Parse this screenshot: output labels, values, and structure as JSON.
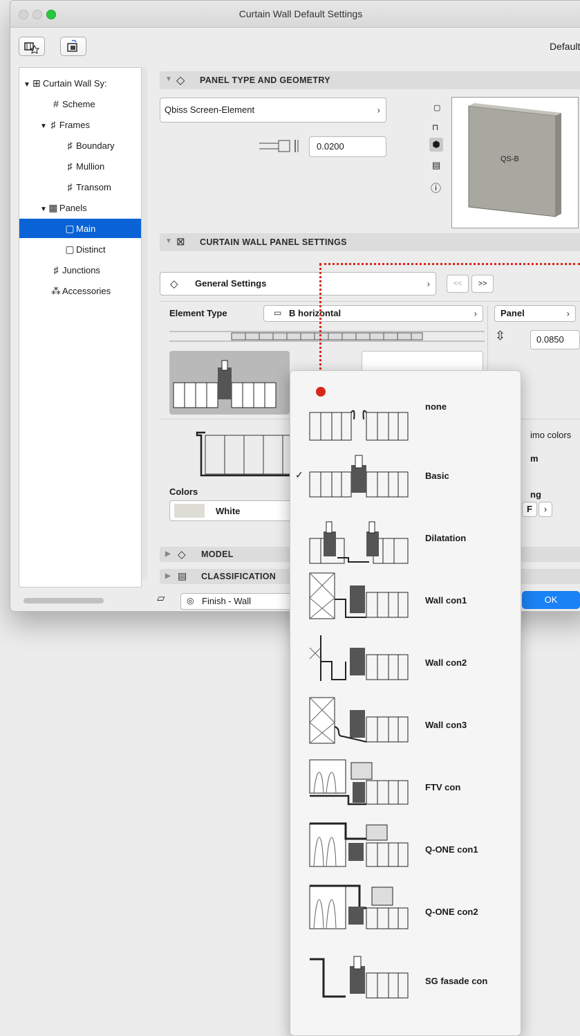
{
  "window": {
    "title": "Curtain Wall Default Settings",
    "favorite": "Default"
  },
  "sidebar": {
    "items": [
      {
        "label": "Curtain Wall Sy:"
      },
      {
        "label": "Scheme"
      },
      {
        "label": "Frames"
      },
      {
        "label": "Boundary"
      },
      {
        "label": "Mullion"
      },
      {
        "label": "Transom"
      },
      {
        "label": "Panels"
      },
      {
        "label": "Main"
      },
      {
        "label": "Distinct"
      },
      {
        "label": "Junctions"
      },
      {
        "label": "Accessories"
      }
    ]
  },
  "panel_type": {
    "section_title": "PANEL TYPE AND GEOMETRY",
    "panel_name": "Qbiss Screen-Element",
    "thickness": "0.0200",
    "preview_label": "QS-B"
  },
  "cw_panel": {
    "section_title": "CURTAIN WALL PANEL SETTINGS",
    "page_name": "General Settings",
    "prev": "<<",
    "next": ">>",
    "element_type_label": "Element Type",
    "element_type_value": "B horizontal",
    "panel_label": "Panel",
    "panel_depth": "0.0850",
    "colors_label": "Colors",
    "color_value": "White",
    "partial_colors": "imo colors",
    "partial_m": "m",
    "partial_ng": "ng",
    "partial_f": "F"
  },
  "sections": {
    "model": "MODEL",
    "classification": "CLASSIFICATION"
  },
  "footer": {
    "layer": "Finish - Wall",
    "ok": "OK"
  },
  "dropdown": {
    "checked": "Basic",
    "options": [
      {
        "label": "none"
      },
      {
        "label": "Basic"
      },
      {
        "label": "Dilatation"
      },
      {
        "label": "Wall con1"
      },
      {
        "label": "Wall con2"
      },
      {
        "label": "Wall con3"
      },
      {
        "label": "FTV con"
      },
      {
        "label": "Q-ONE con1"
      },
      {
        "label": "Q-ONE con2"
      },
      {
        "label": "SG fasade con"
      }
    ]
  },
  "colors": {
    "accent": "#0a63d6",
    "marker": "#d7261b"
  }
}
